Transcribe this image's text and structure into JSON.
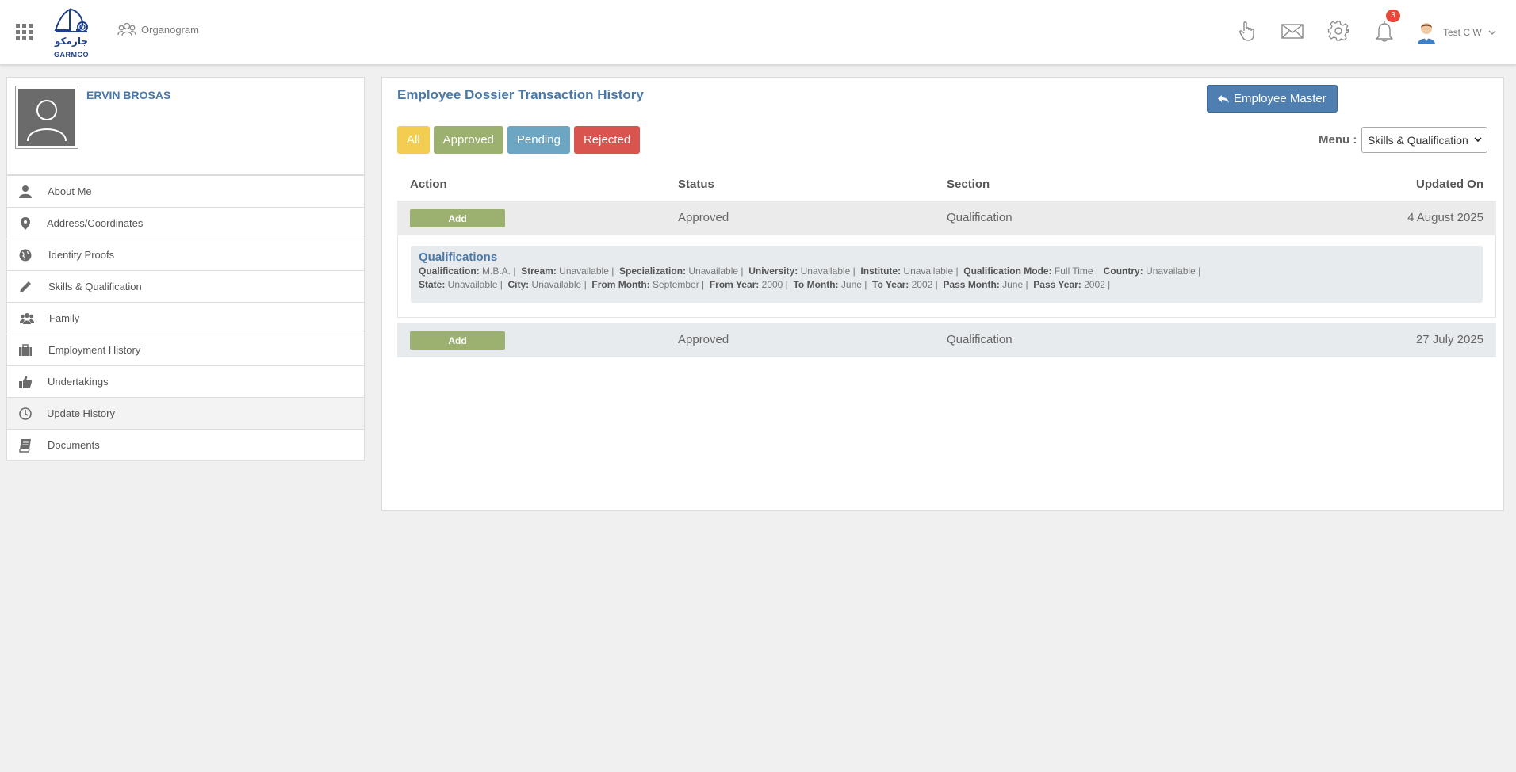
{
  "header": {
    "logo_text": "GARMCO",
    "logo_arabic": "جارمكو",
    "organogram_label": "Organogram",
    "notification_count": "3",
    "user_name": "Test C W"
  },
  "profile": {
    "name": "ERVIN BROSAS"
  },
  "sidebar": {
    "items": [
      {
        "label": "About Me",
        "icon": "user-icon"
      },
      {
        "label": "Address/Coordinates",
        "icon": "map-marker-icon"
      },
      {
        "label": "Identity Proofs",
        "icon": "globe-icon"
      },
      {
        "label": "Skills & Qualification",
        "icon": "pencil-icon"
      },
      {
        "label": "Family",
        "icon": "users-icon"
      },
      {
        "label": "Employment History",
        "icon": "briefcase-icon"
      },
      {
        "label": "Undertakings",
        "icon": "thumbs-up-icon"
      },
      {
        "label": "Update History",
        "icon": "clock-icon"
      },
      {
        "label": "Documents",
        "icon": "book-icon"
      }
    ],
    "active_index": 7
  },
  "main": {
    "title": "Employee Dossier Transaction History",
    "employee_master_label": "Employee Master",
    "filters": {
      "all": "All",
      "approved": "Approved",
      "pending": "Pending",
      "rejected": "Rejected"
    },
    "menu_label": "Menu :",
    "menu_value": "Skills & Qualification",
    "table": {
      "headers": {
        "action": "Action",
        "status": "Status",
        "section": "Section",
        "updated_on": "Updated On"
      },
      "rows": [
        {
          "action": "Add",
          "status": "Approved",
          "section": "Qualification",
          "updated_on": "4 August 2025"
        },
        {
          "action": "Add",
          "status": "Approved",
          "section": "Qualification",
          "updated_on": "27 July 2025"
        }
      ]
    },
    "detail": {
      "title": "Qualifications",
      "line1": [
        {
          "k": "Qualification:",
          "v": "M.B.A."
        },
        {
          "k": "Stream:",
          "v": "Unavailable"
        },
        {
          "k": "Specialization:",
          "v": "Unavailable"
        },
        {
          "k": "University:",
          "v": "Unavailable"
        },
        {
          "k": "Institute:",
          "v": "Unavailable"
        },
        {
          "k": "Qualification Mode:",
          "v": "Full Time"
        },
        {
          "k": "Country:",
          "v": "Unavailable"
        }
      ],
      "line2": [
        {
          "k": "State:",
          "v": "Unavailable"
        },
        {
          "k": "City:",
          "v": "Unavailable"
        },
        {
          "k": "From Month:",
          "v": "September"
        },
        {
          "k": "From Year:",
          "v": "2000"
        },
        {
          "k": "To Month:",
          "v": "June"
        },
        {
          "k": "To Year:",
          "v": "2002"
        },
        {
          "k": "Pass Month:",
          "v": "June"
        },
        {
          "k": "Pass Year:",
          "v": "2002"
        }
      ]
    }
  },
  "colors": {
    "accent_blue": "#4a78a8",
    "btn_all": "#f2cd4f",
    "btn_approved": "#9cb06f",
    "btn_pending": "#6da6c2",
    "btn_rejected": "#d9534f",
    "badge": "#e8483a"
  }
}
